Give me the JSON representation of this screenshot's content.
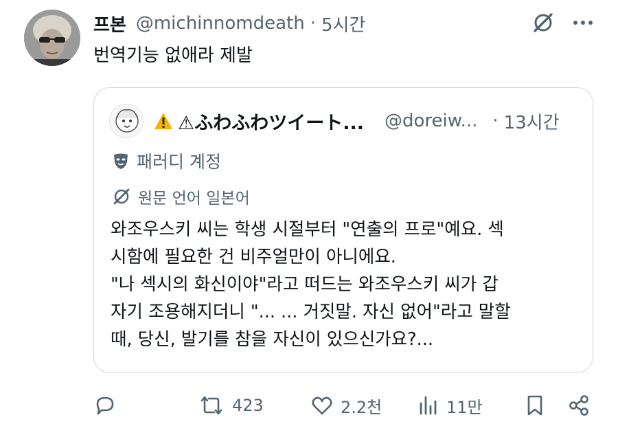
{
  "author": {
    "display_name": "프본",
    "handle": "@michinnomdeath",
    "separator": "·",
    "time": "5시간"
  },
  "tweet_text": "번역기능 없애라 제발",
  "quoted": {
    "display_name": "⚠ふわふわツイート...",
    "handle": "@doreiw...",
    "separator": "·",
    "time": "13시간",
    "parody_label": "패러디 계정",
    "language_label": "원문 언어 일본어",
    "body_lines": [
      "와조우스키 씨는 학생 시절부터 \"연출의 프로\"예요. 섹",
      "시함에 필요한 건 비주얼만이 아니에요.",
      "\"나 섹시의 화신이야\"라고 떠드는 와조우스키 씨가 갑",
      "자기 조용해지더니 \"... ... 거짓말. 자신 없어\"라고 말할",
      "때, 당신, 발기를 참을 자신이 있으신가요?..."
    ]
  },
  "actions": {
    "reply_count": "",
    "retweet_count": "423",
    "like_count": "2.2천",
    "views_count": "11만"
  },
  "colors": {
    "text": "#0f1419",
    "secondary": "#536471",
    "border": "#cfd9de",
    "warning": "#f4b400"
  }
}
